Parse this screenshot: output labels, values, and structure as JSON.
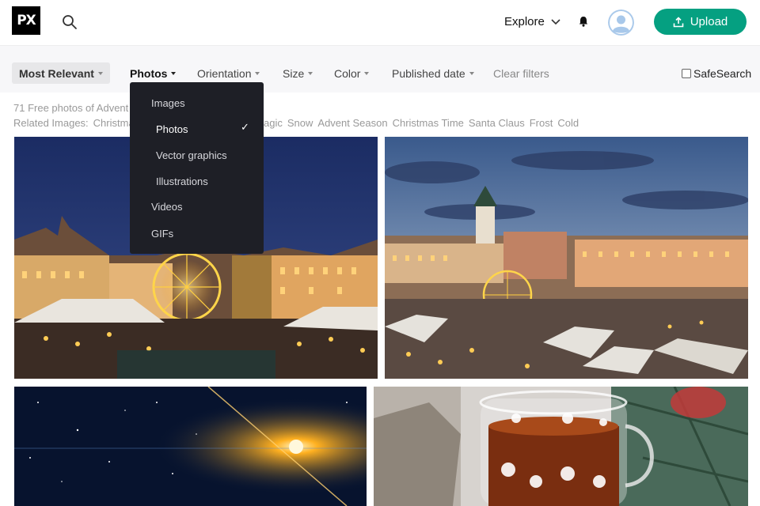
{
  "header": {
    "logo_text": "PX",
    "explore_label": "Explore",
    "upload_label": "Upload"
  },
  "filters": {
    "sort_label": "Most Relevant",
    "items": [
      "Photos",
      "Orientation",
      "Size",
      "Color",
      "Published date"
    ],
    "clear_label": "Clear filters",
    "safesearch_label": "SafeSearch"
  },
  "results": {
    "count_text": "71 Free photos of Advent",
    "related_label": "Related Images:",
    "related_tags": [
      "Christmas",
      "Magic",
      "Snow",
      "Advent Season",
      "Christmas Time",
      "Santa Claus",
      "Frost",
      "Cold"
    ]
  },
  "dropdown": {
    "items": [
      "Images",
      "Photos",
      "Vector graphics",
      "Illustrations",
      "Videos",
      "GIFs"
    ],
    "selected": "Photos",
    "check": "✓"
  },
  "colors": {
    "upload": "#05a081",
    "dropdown_bg": "#1e1f26",
    "filterbar_bg": "#f7f7f9"
  },
  "photos": [
    {
      "subject": "christmas market square at dusk with ferris wheel and fountain"
    },
    {
      "subject": "aerial view of town square with ferris wheel and church tower at sunset"
    },
    {
      "subject": "starry night sky with bright golden star burst"
    },
    {
      "subject": "glass cup of hot tea with snowflake pattern and knitted mitten"
    }
  ]
}
